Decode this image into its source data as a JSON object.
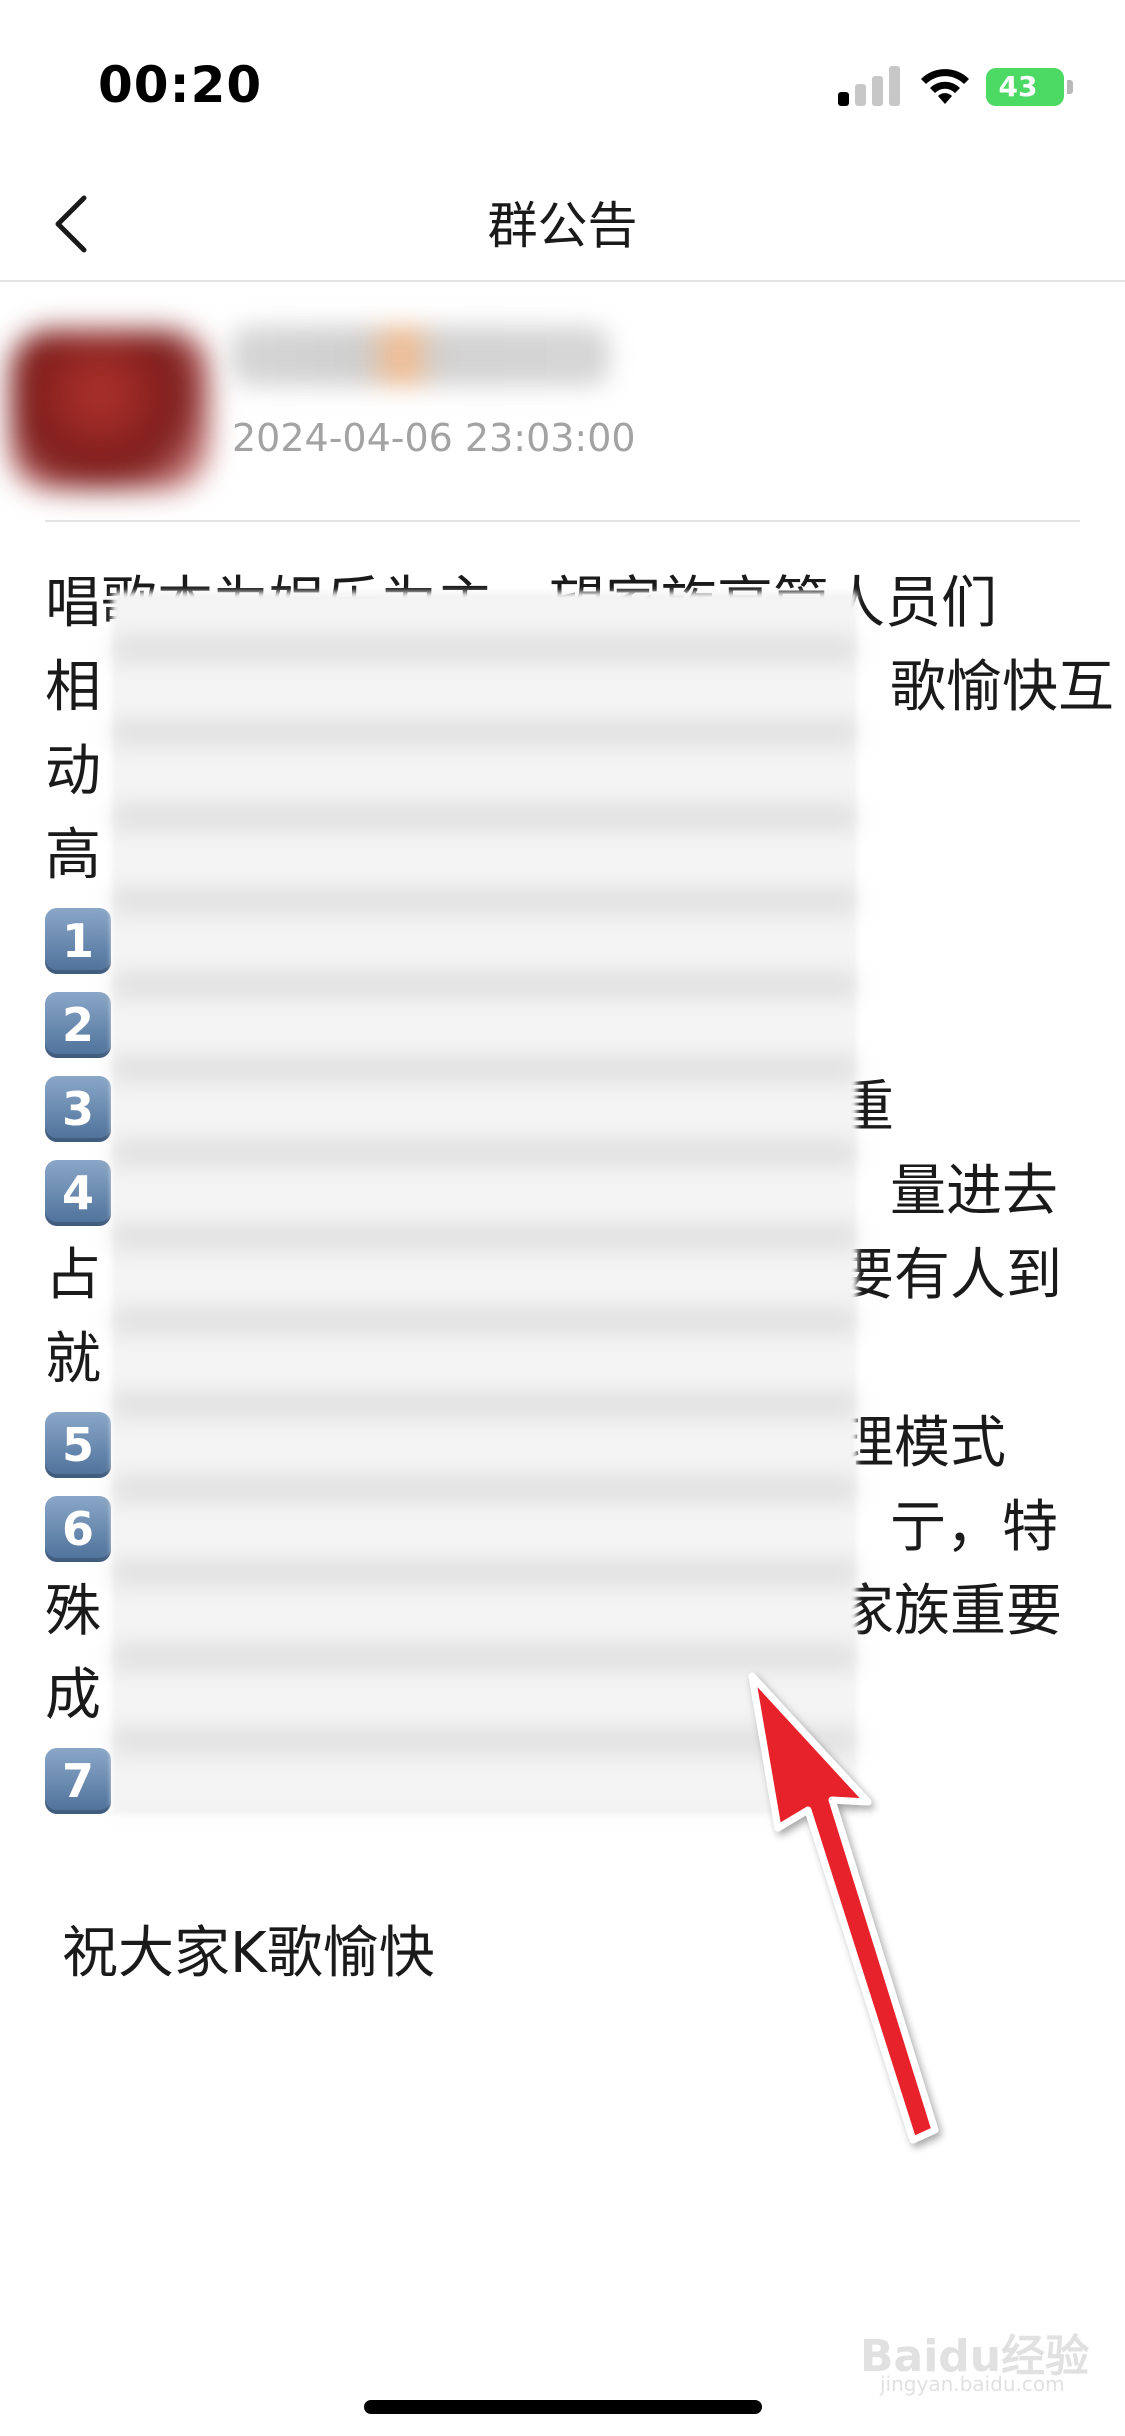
{
  "status_bar": {
    "time": "00:20",
    "battery": "43",
    "colors": {
      "battery": "#4cd964",
      "signal_on": "#000000",
      "signal_off": "#c7c7c7"
    }
  },
  "nav": {
    "title": "群公告",
    "back_icon": "chevron-left-icon"
  },
  "author": {
    "name": "",
    "post_time": "2024-04-06 23:03:00"
  },
  "content": {
    "lines": [
      {
        "left": "唱歌本为娱乐为主，望家族高管人员们",
        "right": ""
      },
      {
        "left": "相",
        "right": "歌愉快互"
      },
      {
        "left": "动",
        "right": ""
      },
      {
        "left": "高",
        "right": ""
      }
    ],
    "numbered_items": [
      {
        "number": "1",
        "tail": ""
      },
      {
        "number": "2",
        "tail": ""
      },
      {
        "number": "3",
        "tail": "重"
      },
      {
        "number": "4",
        "tail": "量进去"
      }
    ],
    "continuation_lines": [
      {
        "left": "占",
        "right": "要有人到"
      },
      {
        "left": "就",
        "right": ""
      }
    ],
    "numbered_items_2": [
      {
        "number": "5",
        "tail": "理模式"
      },
      {
        "number": "6",
        "tail": "亍，特"
      }
    ],
    "continuation_lines_2": [
      {
        "left": "殊",
        "right": "家族重要"
      },
      {
        "left": "成",
        "right": ""
      }
    ],
    "numbered_items_3": [
      {
        "number": "7",
        "tail": ""
      }
    ],
    "closing": "祝大家K歌愉快"
  },
  "annotation": {
    "arrow_color": "#e8232a"
  },
  "watermark": {
    "brand": "Baidu经验",
    "url": "jingyan.baidu.com"
  }
}
